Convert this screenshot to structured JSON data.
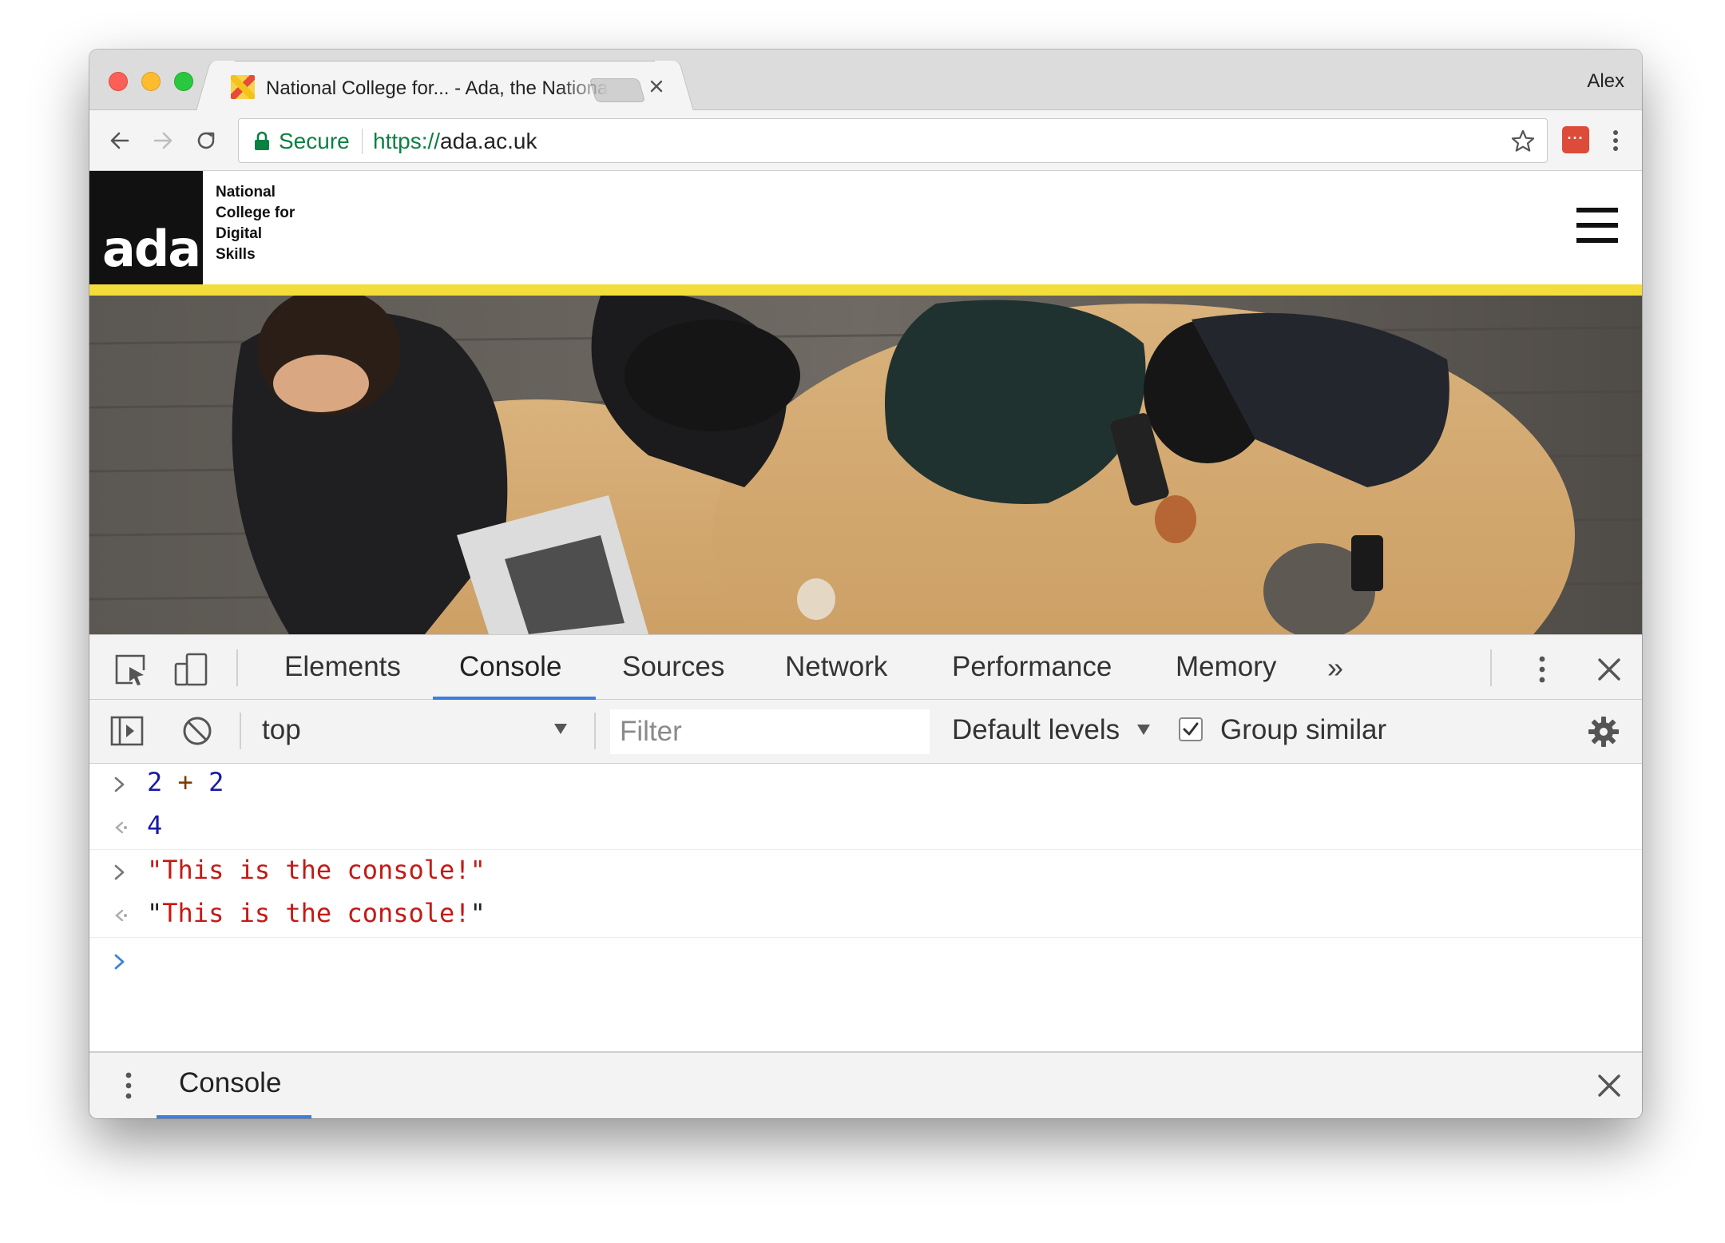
{
  "browser": {
    "tab_title": "National College for... - Ada, the National College for Digital Skills",
    "profile_name": "Alex",
    "secure_label": "Secure",
    "url_scheme": "https://",
    "url_host": "ada.ac.uk"
  },
  "site": {
    "logo_text": "ada",
    "college_name_lines": [
      "National",
      "College for",
      "Digital",
      "Skills"
    ],
    "accent_color": "#f3dd3a"
  },
  "devtools": {
    "tabs": [
      "Elements",
      "Console",
      "Sources",
      "Network",
      "Performance",
      "Memory"
    ],
    "active_tab": "Console",
    "more_tabs_glyph": "»",
    "context": "top",
    "filter_placeholder": "Filter",
    "levels_label": "Default levels",
    "group_similar_label": "Group similar",
    "group_similar_checked": true,
    "drawer_tab": "Console"
  },
  "console": {
    "entries": [
      {
        "kind": "input",
        "parts": [
          {
            "t": "2",
            "c": "num"
          },
          {
            "t": " + ",
            "c": "op"
          },
          {
            "t": "2",
            "c": "num"
          }
        ]
      },
      {
        "kind": "output",
        "parts": [
          {
            "t": "4",
            "c": "num"
          }
        ]
      },
      {
        "kind": "input",
        "parts": [
          {
            "t": "\"This is the console!\"",
            "c": "str"
          }
        ]
      },
      {
        "kind": "output",
        "parts": [
          {
            "t": "\"",
            "c": "plain"
          },
          {
            "t": "This is the console!",
            "c": "str"
          },
          {
            "t": "\"",
            "c": "plain"
          }
        ]
      }
    ]
  },
  "colors": {
    "secure_green": "#0b8043",
    "devtools_accent": "#3b7fe0",
    "console_string": "#c41a16",
    "console_number": "#1a1aa6"
  }
}
